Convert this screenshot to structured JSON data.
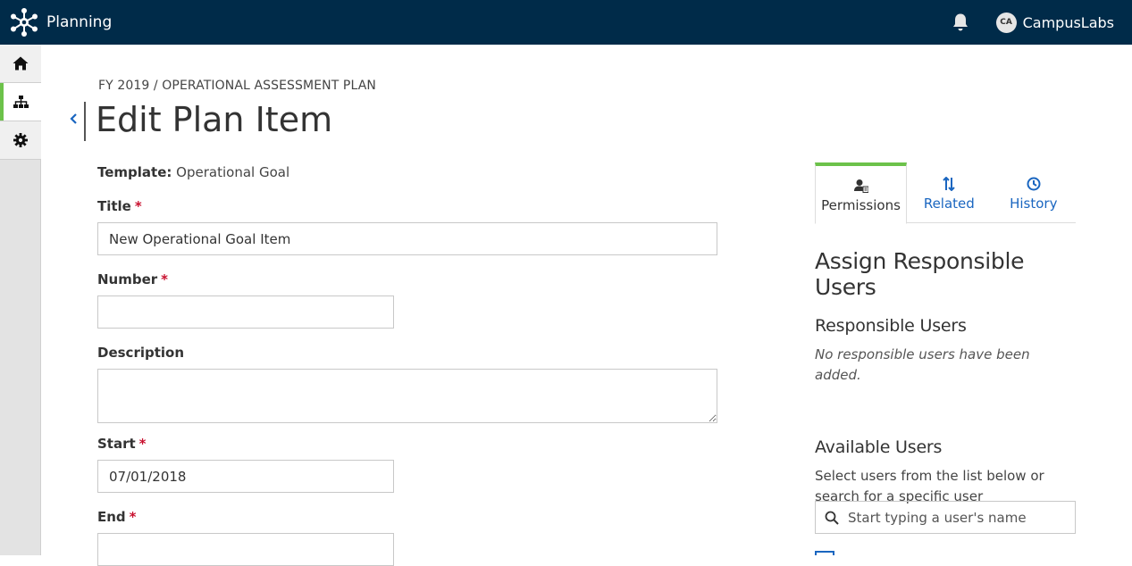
{
  "app": {
    "name": "Planning",
    "user_initials": "CA",
    "user_name": "CampusLabs"
  },
  "colors": {
    "topbar": "#002b49",
    "accent_green": "#6cc24a",
    "link_blue": "#1a66c0",
    "required_red": "#c8102e"
  },
  "sidenav": {
    "items": [
      {
        "name": "home",
        "icon": "home-icon"
      },
      {
        "name": "hierarchy",
        "icon": "sitemap-icon",
        "active": true
      },
      {
        "name": "settings",
        "icon": "gear-icon"
      }
    ]
  },
  "header": {
    "breadcrumb": "FY 2019 / OPERATIONAL ASSESSMENT PLAN",
    "title": "Edit Plan Item"
  },
  "form": {
    "template_label": "Template:",
    "template_value": "Operational Goal",
    "title_label": "Title",
    "title_value": "New Operational Goal Item",
    "number_label": "Number",
    "number_value": "",
    "description_label": "Description",
    "description_value": "",
    "start_label": "Start",
    "start_value": "07/01/2018",
    "end_label": "End",
    "required_mark": "*"
  },
  "tabs": [
    {
      "label": "Permissions",
      "icon": "user-permission-icon",
      "active": true
    },
    {
      "label": "Related",
      "icon": "sort-arrows-icon"
    },
    {
      "label": "History",
      "icon": "clock-icon"
    }
  ],
  "panel": {
    "heading": "Assign Responsible Users",
    "responsible_heading": "Responsible Users",
    "responsible_empty": "No responsible users have been added.",
    "available_heading": "Available Users",
    "available_help": "Select users from the list below or search for a specific user",
    "search_placeholder": "Start typing a user's name"
  }
}
